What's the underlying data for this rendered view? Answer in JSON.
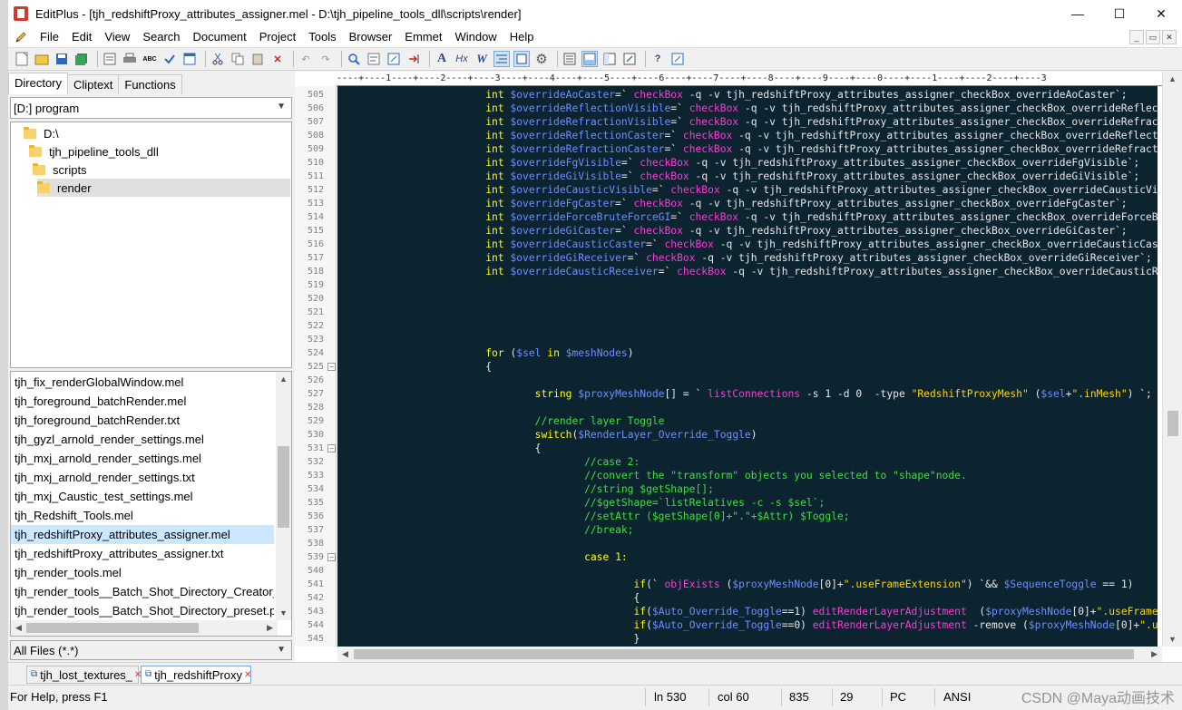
{
  "window": {
    "title": "EditPlus - [tjh_redshiftProxy_attributes_assigner.mel - D:\\tjh_pipeline_tools_dll\\scripts\\render]",
    "minimize": "—",
    "maximize": "☐",
    "close": "✕"
  },
  "menu": [
    "File",
    "Edit",
    "View",
    "Search",
    "Document",
    "Project",
    "Tools",
    "Browser",
    "Emmet",
    "Window",
    "Help"
  ],
  "mdi_buttons": [
    "_",
    "▭",
    "✕"
  ],
  "toolbar": {
    "icons": [
      "new-file-icon",
      "open-file-icon",
      "save-icon",
      "save-all-icon",
      "print-preview-icon",
      "print-icon",
      "spellcheck-icon",
      "check-icon",
      "browser-preview-icon",
      "cut-icon",
      "copy-icon",
      "paste-icon",
      "delete-icon",
      "undo-icon",
      "redo-icon",
      "find-icon",
      "replace-icon",
      "find-in-files-icon",
      "goto-line-icon",
      "font-icon",
      "hex-icon",
      "word-wrap-icon",
      "indent-icon",
      "column-select-icon",
      "settings-icon",
      "window-list-icon",
      "output-window-icon",
      "cliptext-window-icon",
      "fullscreen-icon",
      "help-icon",
      "context-help-icon"
    ],
    "hx_label": "Hx",
    "w_label": "W"
  },
  "sidebar": {
    "tabs": [
      "Directory",
      "Cliptext",
      "Functions"
    ],
    "drive": "[D:] program",
    "tree": [
      "D:\\",
      "tjh_pipeline_tools_dll",
      "scripts",
      "render"
    ],
    "files": [
      "tjh_fix_renderGlobalWindow.mel",
      "tjh_foreground_batchRender.mel",
      "tjh_foreground_batchRender.txt",
      "tjh_gyzl_arnold_render_settings.mel",
      "tjh_mxj_arnold_render_settings.mel",
      "tjh_mxj_arnold_render_settings.txt",
      "tjh_mxj_Caustic_test_settings.mel",
      "tjh_Redshift_Tools.mel",
      "tjh_redshiftProxy_attributes_assigner.mel",
      "tjh_redshiftProxy_attributes_assigner.txt",
      "tjh_render_tools.mel",
      "tjh_render_tools__Batch_Shot_Directory_Creator_p",
      "tjh_render_tools__Batch_Shot_Directory_preset.pre"
    ],
    "selected_file": 8,
    "filter": "All Files (*.*)"
  },
  "editor": {
    "ruler": "----+----1----+----2----+----3----+----4----+----5----+----6----+----7----+----8----+----9----+----0----+----1----+----2----+----3",
    "lines": [
      {
        "n": "505",
        "t": [
          [
            "\t\t\tint ",
            "k"
          ],
          [
            "$overrideAoCaster",
            "v"
          ],
          [
            "=` ",
            "w"
          ],
          [
            "checkBox",
            "f"
          ],
          [
            " -q -v tjh_redshiftProxy_attributes_assigner_checkBox_overrideAoCaster`;",
            "w"
          ]
        ]
      },
      {
        "n": "506",
        "t": [
          [
            "\t\t\tint ",
            "k"
          ],
          [
            "$overrideReflectionVisible",
            "v"
          ],
          [
            "=` ",
            "w"
          ],
          [
            "checkBox",
            "f"
          ],
          [
            " -q -v tjh_redshiftProxy_attributes_assigner_checkBox_overrideReflectionVisible`;",
            "w"
          ]
        ]
      },
      {
        "n": "507",
        "t": [
          [
            "\t\t\tint ",
            "k"
          ],
          [
            "$overrideRefractionVisible",
            "v"
          ],
          [
            "=` ",
            "w"
          ],
          [
            "checkBox",
            "f"
          ],
          [
            " -q -v tjh_redshiftProxy_attributes_assigner_checkBox_overrideRefractionVisible`;",
            "w"
          ]
        ]
      },
      {
        "n": "508",
        "t": [
          [
            "\t\t\tint ",
            "k"
          ],
          [
            "$overrideReflectionCaster",
            "v"
          ],
          [
            "=` ",
            "w"
          ],
          [
            "checkBox",
            "f"
          ],
          [
            " -q -v tjh_redshiftProxy_attributes_assigner_checkBox_overrideReflectionCaster`;",
            "w"
          ]
        ]
      },
      {
        "n": "509",
        "t": [
          [
            "\t\t\tint ",
            "k"
          ],
          [
            "$overrideRefractionCaster",
            "v"
          ],
          [
            "=` ",
            "w"
          ],
          [
            "checkBox",
            "f"
          ],
          [
            " -q -v tjh_redshiftProxy_attributes_assigner_checkBox_overrideRefractionCaster`;",
            "w"
          ]
        ]
      },
      {
        "n": "510",
        "t": [
          [
            "\t\t\tint ",
            "k"
          ],
          [
            "$overrideFgVisible",
            "v"
          ],
          [
            "=` ",
            "w"
          ],
          [
            "checkBox",
            "f"
          ],
          [
            " -q -v tjh_redshiftProxy_attributes_assigner_checkBox_overrideFgVisible`;",
            "w"
          ]
        ]
      },
      {
        "n": "511",
        "t": [
          [
            "\t\t\tint ",
            "k"
          ],
          [
            "$overrideGiVisible",
            "v"
          ],
          [
            "=` ",
            "w"
          ],
          [
            "checkBox",
            "f"
          ],
          [
            " -q -v tjh_redshiftProxy_attributes_assigner_checkBox_overrideGiVisible`;",
            "w"
          ]
        ]
      },
      {
        "n": "512",
        "t": [
          [
            "\t\t\tint ",
            "k"
          ],
          [
            "$overrideCausticVisible",
            "v"
          ],
          [
            "=` ",
            "w"
          ],
          [
            "checkBox",
            "f"
          ],
          [
            " -q -v tjh_redshiftProxy_attributes_assigner_checkBox_overrideCausticVisible`;",
            "w"
          ]
        ]
      },
      {
        "n": "513",
        "t": [
          [
            "\t\t\tint ",
            "k"
          ],
          [
            "$overrideFgCaster",
            "v"
          ],
          [
            "=` ",
            "w"
          ],
          [
            "checkBox",
            "f"
          ],
          [
            " -q -v tjh_redshiftProxy_attributes_assigner_checkBox_overrideFgCaster`;",
            "w"
          ]
        ]
      },
      {
        "n": "514",
        "t": [
          [
            "\t\t\tint ",
            "k"
          ],
          [
            "$overrideForceBruteForceGI",
            "v"
          ],
          [
            "=` ",
            "w"
          ],
          [
            "checkBox",
            "f"
          ],
          [
            " -q -v tjh_redshiftProxy_attributes_assigner_checkBox_overrideForceBruteForceGI`;",
            "w"
          ]
        ]
      },
      {
        "n": "515",
        "t": [
          [
            "\t\t\tint ",
            "k"
          ],
          [
            "$overrideGiCaster",
            "v"
          ],
          [
            "=` ",
            "w"
          ],
          [
            "checkBox",
            "f"
          ],
          [
            " -q -v tjh_redshiftProxy_attributes_assigner_checkBox_overrideGiCaster`;",
            "w"
          ]
        ]
      },
      {
        "n": "516",
        "t": [
          [
            "\t\t\tint ",
            "k"
          ],
          [
            "$overrideCausticCaster",
            "v"
          ],
          [
            "=` ",
            "w"
          ],
          [
            "checkBox",
            "f"
          ],
          [
            " -q -v tjh_redshiftProxy_attributes_assigner_checkBox_overrideCausticCaster`;",
            "w"
          ]
        ]
      },
      {
        "n": "517",
        "t": [
          [
            "\t\t\tint ",
            "k"
          ],
          [
            "$overrideGiReceiver",
            "v"
          ],
          [
            "=` ",
            "w"
          ],
          [
            "checkBox",
            "f"
          ],
          [
            " -q -v tjh_redshiftProxy_attributes_assigner_checkBox_overrideGiReceiver`;",
            "w"
          ]
        ]
      },
      {
        "n": "518",
        "t": [
          [
            "\t\t\tint ",
            "k"
          ],
          [
            "$overrideCausticReceiver",
            "v"
          ],
          [
            "=` ",
            "w"
          ],
          [
            "checkBox",
            "f"
          ],
          [
            " -q -v tjh_redshiftProxy_attributes_assigner_checkBox_overrideCausticReceiver`;",
            "w"
          ]
        ]
      },
      {
        "n": "519",
        "t": []
      },
      {
        "n": "520",
        "t": []
      },
      {
        "n": "521",
        "t": []
      },
      {
        "n": "522",
        "t": []
      },
      {
        "n": "523",
        "t": []
      },
      {
        "n": "524",
        "t": [
          [
            "\t\t\tfor ",
            "k"
          ],
          [
            "(",
            "w"
          ],
          [
            "$sel",
            "v"
          ],
          [
            " in ",
            "k"
          ],
          [
            "$meshNodes",
            "v"
          ],
          [
            ")",
            "w"
          ]
        ]
      },
      {
        "n": "525",
        "t": [
          [
            "\t\t\t{",
            "w"
          ]
        ],
        "fold": true
      },
      {
        "n": "526",
        "t": []
      },
      {
        "n": "527",
        "t": [
          [
            "\t\t\t\tstring ",
            "k"
          ],
          [
            "$proxyMeshNode",
            "v"
          ],
          [
            "[] = ` ",
            "w"
          ],
          [
            "listConnections",
            "f"
          ],
          [
            " -s 1 -d 0  -type ",
            "w"
          ],
          [
            "\"RedshiftProxyMesh\"",
            "s"
          ],
          [
            " (",
            "w"
          ],
          [
            "$sel",
            "v"
          ],
          [
            "+",
            "w"
          ],
          [
            "\".inMesh\"",
            "s"
          ],
          [
            ") `;",
            "w"
          ]
        ]
      },
      {
        "n": "528",
        "t": []
      },
      {
        "n": "529",
        "t": [
          [
            "\t\t\t\t//render layer Toggle",
            "c"
          ]
        ]
      },
      {
        "n": "530",
        "t": [
          [
            "\t\t\t\tswitch",
            "k"
          ],
          [
            "(",
            "w"
          ],
          [
            "$RenderLayer_Override_Toggle",
            "v"
          ],
          [
            ")",
            "w"
          ]
        ]
      },
      {
        "n": "531",
        "t": [
          [
            "\t\t\t\t{",
            "w"
          ]
        ],
        "fold": true
      },
      {
        "n": "532",
        "t": [
          [
            "\t\t\t\t\t//case 2:",
            "c"
          ]
        ]
      },
      {
        "n": "533",
        "t": [
          [
            "\t\t\t\t\t//convert the \"transform\" objects you selected to \"shape\"node.",
            "c"
          ]
        ]
      },
      {
        "n": "534",
        "t": [
          [
            "\t\t\t\t\t//string $getShape[];",
            "c"
          ]
        ]
      },
      {
        "n": "535",
        "t": [
          [
            "\t\t\t\t\t//$getShape=`listRelatives -c -s $sel`;",
            "c"
          ]
        ]
      },
      {
        "n": "536",
        "t": [
          [
            "\t\t\t\t\t//setAttr ($getShape[0]+\".\"+$Attr) $Toggle;",
            "c"
          ]
        ]
      },
      {
        "n": "537",
        "t": [
          [
            "\t\t\t\t\t//break;",
            "c"
          ]
        ]
      },
      {
        "n": "538",
        "t": []
      },
      {
        "n": "539",
        "t": [
          [
            "\t\t\t\t\tcase 1:",
            "k"
          ]
        ],
        "fold": true
      },
      {
        "n": "540",
        "t": []
      },
      {
        "n": "541",
        "t": [
          [
            "\t\t\t\t\t\tif",
            "k"
          ],
          [
            "(` ",
            "w"
          ],
          [
            "objExists",
            "f"
          ],
          [
            " (",
            "w"
          ],
          [
            "$proxyMeshNode",
            "v"
          ],
          [
            "[0]+",
            "w"
          ],
          [
            "\".useFrameExtension\"",
            "s"
          ],
          [
            ") `&& ",
            "w"
          ],
          [
            "$SequenceToggle",
            "v"
          ],
          [
            " == 1)",
            "w"
          ]
        ]
      },
      {
        "n": "542",
        "t": [
          [
            "\t\t\t\t\t\t{",
            "w"
          ]
        ]
      },
      {
        "n": "543",
        "t": [
          [
            "\t\t\t\t\t\tif",
            "k"
          ],
          [
            "(",
            "w"
          ],
          [
            "$Auto_Override_Toggle",
            "v"
          ],
          [
            "==1) ",
            "w"
          ],
          [
            "editRenderLayerAdjustment",
            "f"
          ],
          [
            "  (",
            "w"
          ],
          [
            "$proxyMeshNode",
            "v"
          ],
          [
            "[0]+",
            "w"
          ],
          [
            "\".useFrameExtension\"",
            "s"
          ],
          [
            ");",
            "w"
          ]
        ]
      },
      {
        "n": "544",
        "t": [
          [
            "\t\t\t\t\t\tif",
            "k"
          ],
          [
            "(",
            "w"
          ],
          [
            "$Auto_Override_Toggle",
            "v"
          ],
          [
            "==0) ",
            "w"
          ],
          [
            "editRenderLayerAdjustment",
            "f"
          ],
          [
            " -remove (",
            "w"
          ],
          [
            "$proxyMeshNode",
            "v"
          ],
          [
            "[0]+",
            "w"
          ],
          [
            "\".useFrameExtension\"",
            "s"
          ],
          [
            ");",
            "w"
          ]
        ]
      },
      {
        "n": "545",
        "t": [
          [
            "\t\t\t\t\t\t}",
            "w"
          ]
        ]
      }
    ],
    "colors": {
      "k": "#ffff00",
      "v": "#6f8fff",
      "f": "#ff3ad6",
      "s": "#ffd400",
      "c": "#3ce03c",
      "w": "#e8e8e8",
      "bg": "#0c2330"
    }
  },
  "doc_tabs": [
    {
      "label": "tjh_lost_textures_",
      "active": false
    },
    {
      "label": "tjh_redshiftProxy",
      "active": true
    }
  ],
  "status": {
    "help": "For Help, press F1",
    "line": "ln 530",
    "col": "col 60",
    "total": "835",
    "sel": "29",
    "mode": "PC",
    "encoding": "ANSI",
    "watermark": "CSDN @Maya动画技术"
  }
}
